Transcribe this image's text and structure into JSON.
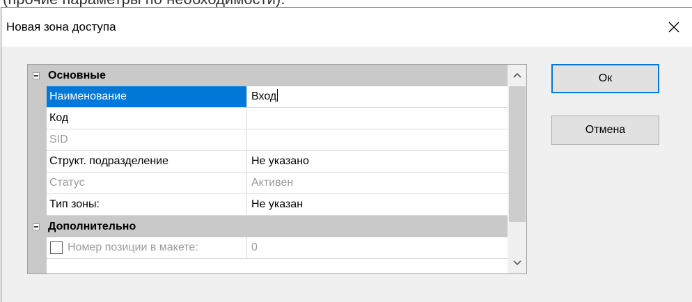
{
  "context_caption": "(прочие параметры по необходимости).",
  "window": {
    "title": "Новая зона доступа",
    "close_symbol": "✕"
  },
  "property_grid": {
    "categories": [
      {
        "label": "Основные",
        "expanded": true,
        "rows": [
          {
            "name": "Наименование",
            "value": "Вход",
            "selected": true,
            "enabled": true
          },
          {
            "name": "Код",
            "value": "",
            "selected": false,
            "enabled": true
          },
          {
            "name": "SID",
            "value": "",
            "selected": false,
            "enabled": false
          },
          {
            "name": "Структ. подразделение",
            "value": "Не указано",
            "selected": false,
            "enabled": true
          },
          {
            "name": "Статус",
            "value": "Активен",
            "selected": false,
            "enabled": false
          },
          {
            "name": "Тип зоны:",
            "value": "Не указан",
            "selected": false,
            "enabled": true
          }
        ]
      },
      {
        "label": "Дополнительно",
        "expanded": true,
        "rows": [
          {
            "name": "Номер позиции в макете:",
            "value": "0",
            "checked": false,
            "enabled": false
          }
        ]
      }
    ]
  },
  "buttons": {
    "ok_label": "Ок",
    "cancel_label": "Отмена"
  },
  "colors": {
    "selection": "#0078d7",
    "category_band": "#c9c9c9",
    "dialog_background": "#f0f0f0"
  },
  "icons": {
    "close": "close-icon",
    "collapse": "minus-icon",
    "scroll_up": "chevron-up-icon",
    "scroll_down": "chevron-down-icon"
  }
}
